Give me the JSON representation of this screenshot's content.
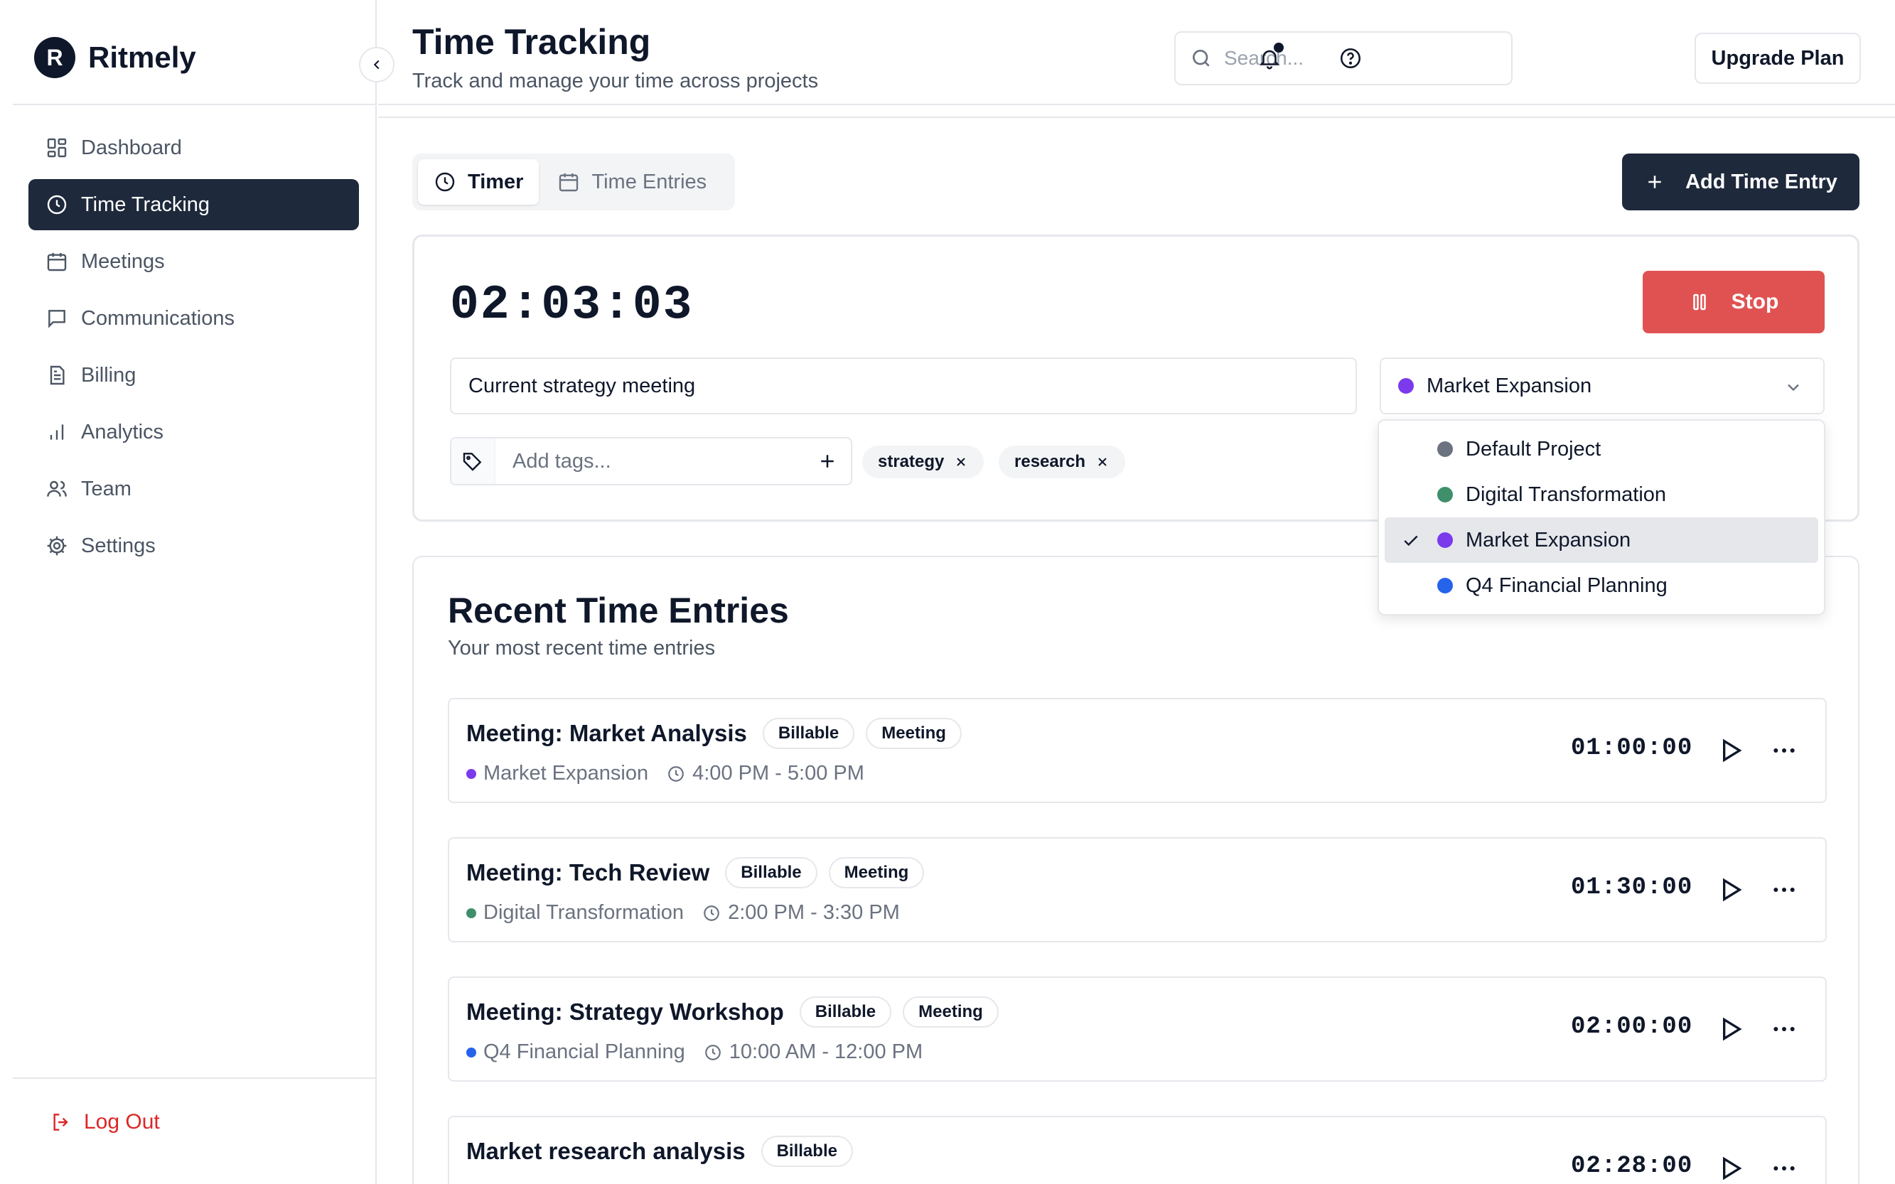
{
  "brand": {
    "logo_letter": "R",
    "name": "Ritmely"
  },
  "sidebar": {
    "items": [
      {
        "label": "Dashboard",
        "icon": "dashboard-icon",
        "active": false
      },
      {
        "label": "Time Tracking",
        "icon": "clock-icon",
        "active": true
      },
      {
        "label": "Meetings",
        "icon": "calendar-icon",
        "active": false
      },
      {
        "label": "Communications",
        "icon": "message-icon",
        "active": false
      },
      {
        "label": "Billing",
        "icon": "document-icon",
        "active": false
      },
      {
        "label": "Analytics",
        "icon": "bar-chart-icon",
        "active": false
      },
      {
        "label": "Team",
        "icon": "users-icon",
        "active": false
      },
      {
        "label": "Settings",
        "icon": "gear-icon",
        "active": false
      }
    ],
    "logout_label": "Log Out"
  },
  "header": {
    "title": "Time Tracking",
    "subtitle": "Track and manage your time across projects",
    "search_placeholder": "Search...",
    "upgrade_label": "Upgrade Plan"
  },
  "tabs": [
    {
      "label": "Timer",
      "icon": "clock-icon",
      "active": true
    },
    {
      "label": "Time Entries",
      "icon": "calendar-icon",
      "active": false
    }
  ],
  "add_entry_label": "Add Time Entry",
  "timer": {
    "display": "02:03:03",
    "stop_label": "Stop",
    "description_value": "Current strategy meeting",
    "selected_project": "Market Expansion",
    "selected_project_color": "#7c3aed",
    "tags_placeholder": "Add tags...",
    "tags": [
      "strategy",
      "research"
    ]
  },
  "project_dropdown": {
    "options": [
      {
        "label": "Default Project",
        "color": "#6b7280",
        "selected": false
      },
      {
        "label": "Digital Transformation",
        "color": "#3f8f6b",
        "selected": false
      },
      {
        "label": "Market Expansion",
        "color": "#7c3aed",
        "selected": true
      },
      {
        "label": "Q4 Financial Planning",
        "color": "#2563eb",
        "selected": false
      }
    ]
  },
  "recent": {
    "title": "Recent Time Entries",
    "subtitle": "Your most recent time entries",
    "entries": [
      {
        "title": "Meeting: Market Analysis",
        "badges": [
          "Billable",
          "Meeting"
        ],
        "project": "Market Expansion",
        "project_color": "#7c3aed",
        "time_range": "4:00 PM - 5:00 PM",
        "duration": "01:00:00"
      },
      {
        "title": "Meeting: Tech Review",
        "badges": [
          "Billable",
          "Meeting"
        ],
        "project": "Digital Transformation",
        "project_color": "#3f8f6b",
        "time_range": "2:00 PM - 3:30 PM",
        "duration": "01:30:00"
      },
      {
        "title": "Meeting: Strategy Workshop",
        "badges": [
          "Billable",
          "Meeting"
        ],
        "project": "Q4 Financial Planning",
        "project_color": "#2563eb",
        "time_range": "10:00 AM - 12:00 PM",
        "duration": "02:00:00"
      },
      {
        "title": "Market research analysis",
        "badges": [
          "Billable"
        ],
        "project": "",
        "project_color": "",
        "time_range": "",
        "duration": "02:28:00"
      }
    ]
  },
  "colors": {
    "primary_dark": "#1e293b",
    "stop_red": "#e05252",
    "logout_red": "#dc2626",
    "border": "#e5e7eb"
  }
}
